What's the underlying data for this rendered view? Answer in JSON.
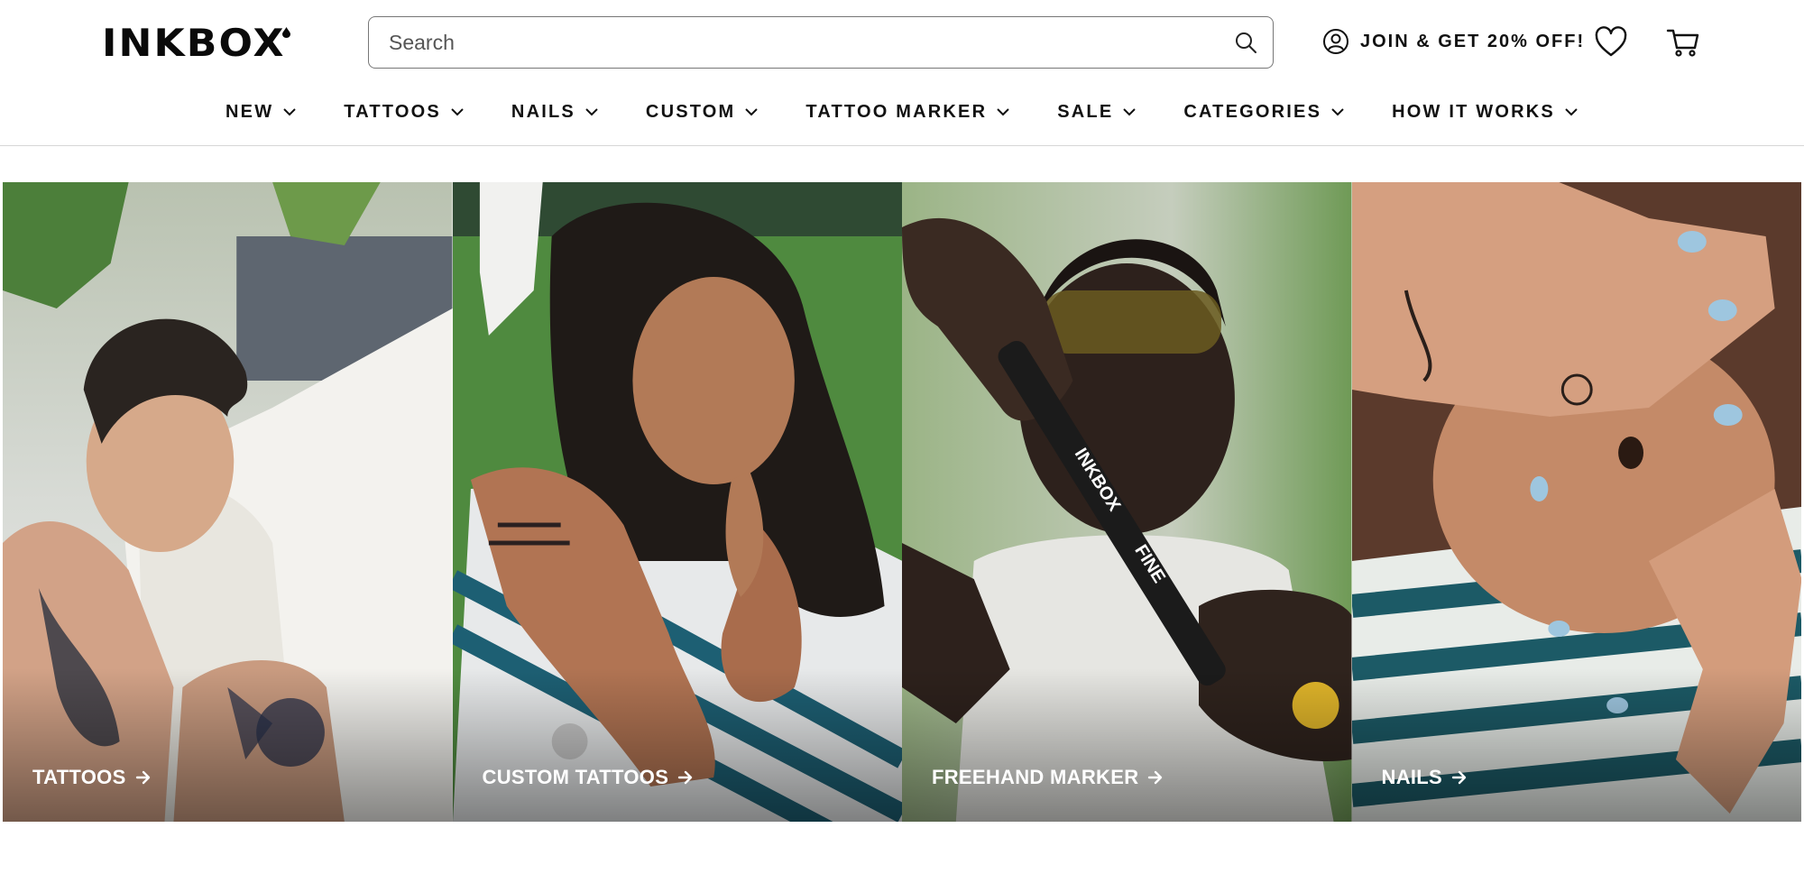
{
  "brand": {
    "name": "INKBOX"
  },
  "search": {
    "placeholder": "Search"
  },
  "header": {
    "join_label": "JOIN & GET 20% OFF!"
  },
  "nav": {
    "items": [
      {
        "label": "NEW"
      },
      {
        "label": "TATTOOS"
      },
      {
        "label": "NAILS"
      },
      {
        "label": "CUSTOM"
      },
      {
        "label": "TATTOO MARKER"
      },
      {
        "label": "SALE"
      },
      {
        "label": "CATEGORIES"
      },
      {
        "label": "HOW IT WORKS"
      }
    ]
  },
  "tiles": [
    {
      "label": "TATTOOS"
    },
    {
      "label": "CUSTOM TATTOOS"
    },
    {
      "label": "FREEHAND MARKER"
    },
    {
      "label": "NAILS"
    }
  ],
  "marker_text": {
    "line1": "INKBOX",
    "line2": "FINE"
  },
  "icons": {
    "search": "search-icon",
    "account": "user-circle-icon",
    "wishlist": "heart-icon",
    "cart": "cart-icon",
    "chevron": "chevron-down-icon",
    "arrow": "arrow-right-icon"
  },
  "colors": {
    "text": "#111111",
    "border": "#777777",
    "divider": "#d6d6d6",
    "tile_text": "#ffffff"
  }
}
